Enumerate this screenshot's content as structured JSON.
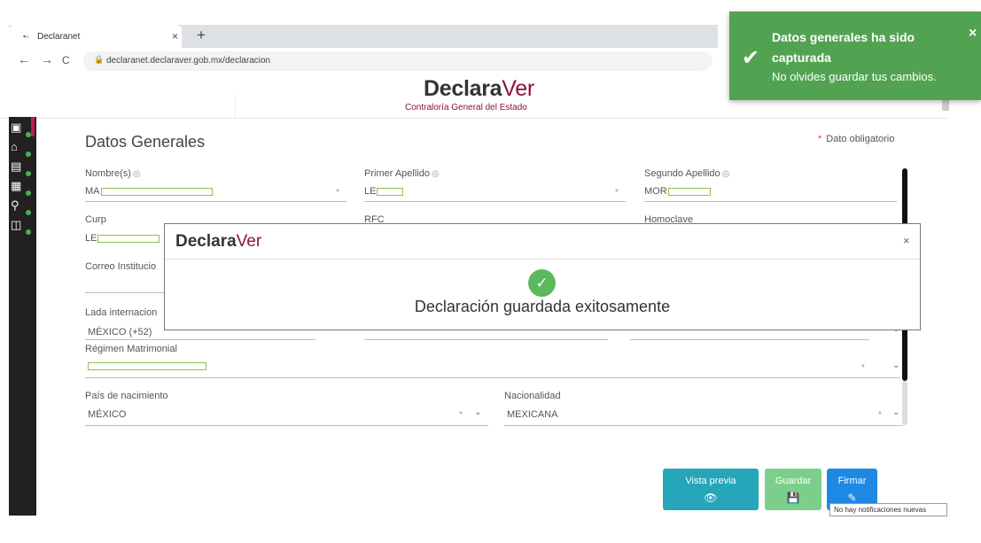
{
  "browser": {
    "tab_title": "Declaranet",
    "tab_favicon": "▪▫",
    "tab_close": "×",
    "new_tab": "+",
    "back": "←",
    "forward": "→",
    "reload": "C",
    "url": "declaranet.declaraver.gob.mx/declaracion"
  },
  "header": {
    "brand_bold": "Declara",
    "brand_light": "Ver",
    "subtitle": "Contraloría General del Estado"
  },
  "form": {
    "title": "Datos Generales",
    "required_note": "Dato obligatorio",
    "required_mark": "*",
    "help_mark": "◎",
    "chevron": "⌄",
    "fields": {
      "nombre": {
        "label": "Nombre(s)",
        "value": "MA"
      },
      "primer_apellido": {
        "label": "Primer Apellido",
        "value": "LE"
      },
      "segundo_apellido": {
        "label": "Segundo Apellido",
        "value": "MOR"
      },
      "curp": {
        "label": "Curp",
        "value": "LE"
      },
      "rfc": {
        "label": "RFC"
      },
      "homoclave": {
        "label": "Homoclave"
      },
      "correo": {
        "label": "Correo Institucio"
      },
      "lada": {
        "label": "Lada internacion",
        "value": "MÉXICO (+52)"
      },
      "regimen": {
        "label": "Régimen Matrimonial"
      },
      "pais": {
        "label": "País de nacimiento",
        "value": "MÉXICO"
      },
      "nacionalidad": {
        "label": "Nacionalidad",
        "value": "MEXICANA"
      }
    }
  },
  "buttons": {
    "preview": {
      "label": "Vista previa",
      "icon": "👁"
    },
    "save": {
      "label": "Guardar",
      "icon": "💾"
    },
    "sign": {
      "label": "Firmar",
      "icon": "✎"
    }
  },
  "tooltip": "No hay notificaciones nuevas",
  "modal": {
    "brand_bold": "Declara",
    "brand_light": "Ver",
    "close": "×",
    "check": "✓",
    "message": "Declaración guardada exitosamente"
  },
  "toast": {
    "check": "✔",
    "title": "Datos generales ha sido capturada",
    "message": "No olvides guardar tus cambios.",
    "close": "×"
  },
  "colors": {
    "brand_accent": "#8a1538",
    "toast_bg": "#51a351",
    "success": "#5cb85c",
    "preview_btn": "#26a6b8",
    "save_btn": "#7ccf8a",
    "sign_btn": "#1e88e5"
  },
  "sidebar": {
    "icons": [
      {
        "name": "id-card-icon",
        "glyph": "▣"
      },
      {
        "name": "home-icon",
        "glyph": "⌂"
      },
      {
        "name": "document-icon",
        "glyph": "▤"
      },
      {
        "name": "briefcase-icon",
        "glyph": "▦"
      },
      {
        "name": "network-icon",
        "glyph": "⚲"
      },
      {
        "name": "search-doc-icon",
        "glyph": "◫"
      }
    ]
  }
}
